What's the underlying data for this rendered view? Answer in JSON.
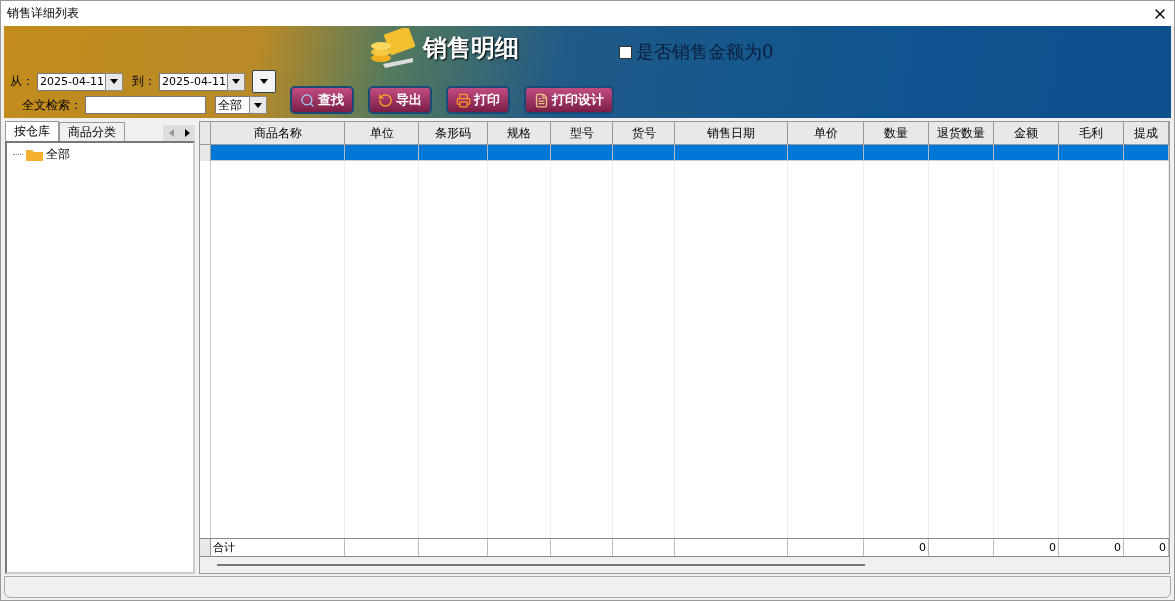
{
  "window": {
    "title": "销售详细列表"
  },
  "banner": {
    "title": "销售明细",
    "zero_amount": {
      "label": "是否销售金额为0",
      "checked": false
    }
  },
  "filters": {
    "from_label": "从：",
    "from_date": "2025-04-11",
    "to_label": "到：",
    "to_date": "2025-04-11",
    "search_label": "全文检索：",
    "scope": "全部"
  },
  "buttons": [
    {
      "label": "查找",
      "kind": "search"
    },
    {
      "label": "导出",
      "kind": "export"
    },
    {
      "label": "打印",
      "kind": "print"
    },
    {
      "label": "打印设计",
      "kind": "design"
    }
  ],
  "left_panel": {
    "tabs": [
      {
        "label": "按仓库",
        "selected": true
      },
      {
        "label": "商品分类",
        "selected": false
      }
    ],
    "tree": [
      {
        "label": "全部"
      }
    ]
  },
  "table": {
    "columns": [
      "商品名称",
      "单位",
      "条形码",
      "规格",
      "型号",
      "货号",
      "销售日期",
      "单价",
      "数量",
      "退货数量",
      "金额",
      "毛利",
      "提成"
    ],
    "rows": [
      {
        "selected": true
      }
    ],
    "totals": {
      "label": "合计",
      "quantity": "0",
      "amount": "0",
      "profit": "0",
      "commission": "0"
    }
  }
}
